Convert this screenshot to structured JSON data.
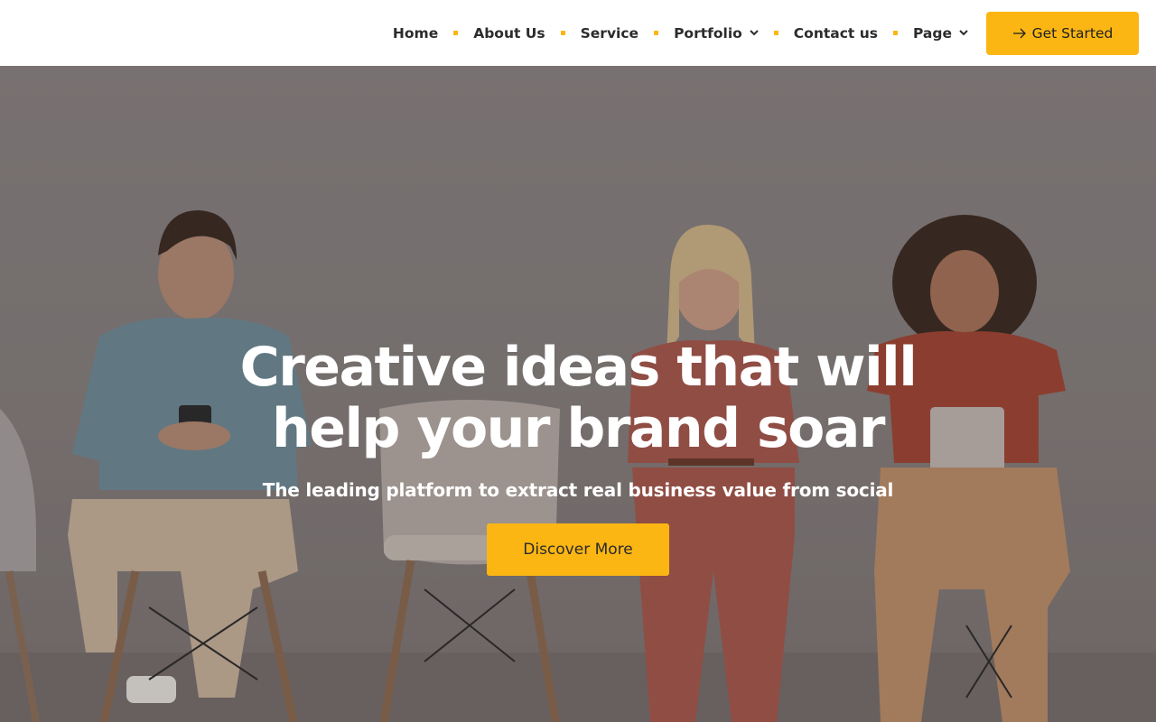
{
  "nav": {
    "items": [
      {
        "label": "Home",
        "has_dropdown": false
      },
      {
        "label": "About Us",
        "has_dropdown": false
      },
      {
        "label": "Service",
        "has_dropdown": false
      },
      {
        "label": "Portfolio",
        "has_dropdown": true
      },
      {
        "label": "Contact us",
        "has_dropdown": false
      },
      {
        "label": "Page",
        "has_dropdown": true
      }
    ],
    "cta_label": "Get Started",
    "cta_icon": "arrow-right-icon",
    "dropdown_icon": "chevron-down-icon"
  },
  "hero": {
    "title": "Creative ideas that will help your brand soar",
    "subtitle": "The leading platform to extract real business value from social",
    "button_label": "Discover More",
    "image": "people-sitting-on-chairs-with-devices"
  },
  "colors": {
    "accent": "#fbb614",
    "nav_text": "#2c2c2c",
    "hero_text": "#ffffff"
  }
}
